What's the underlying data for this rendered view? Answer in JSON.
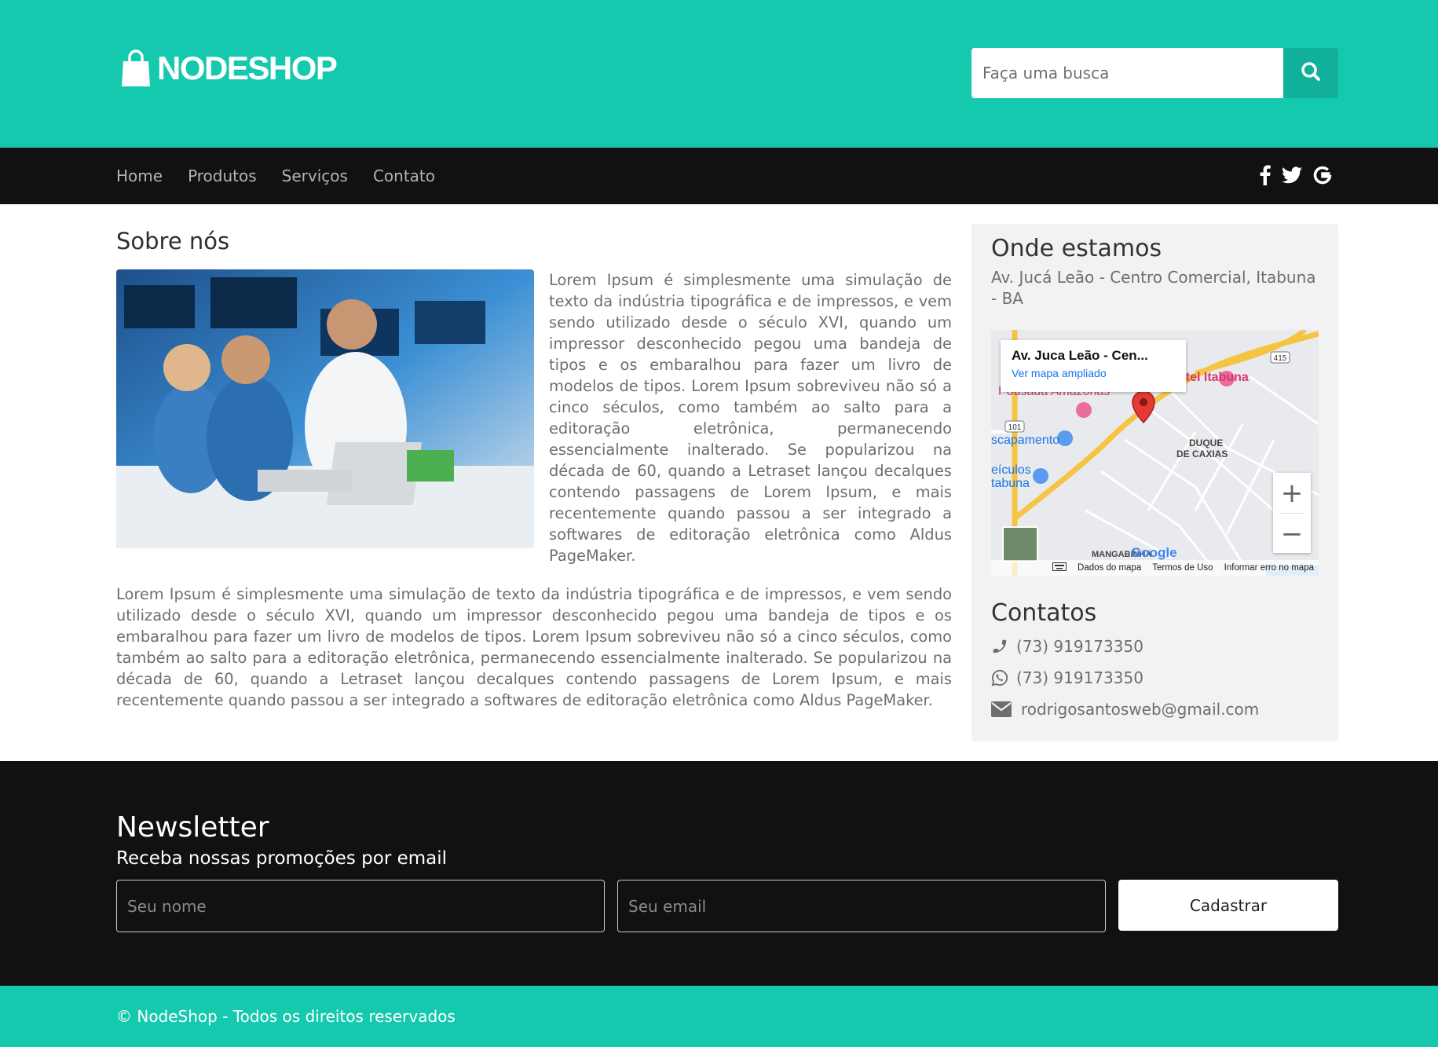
{
  "header": {
    "logo_text": "NODESHOP",
    "search_placeholder": "Faça uma busca"
  },
  "nav": {
    "items": [
      "Home",
      "Produtos",
      "Serviços",
      "Contato"
    ],
    "social_icons": [
      "facebook-icon",
      "twitter-icon",
      "google-icon"
    ]
  },
  "about": {
    "title": "Sobre nós",
    "paragraph1": "Lorem Ipsum é simplesmente uma simulação de texto da indústria tipográfica e de impressos, e vem sendo utilizado desde o século XVI, quando um impressor desconhecido pegou uma bandeja de tipos e os embaralhou para fazer um livro de modelos de tipos. Lorem Ipsum sobreviveu não só a cinco séculos, como também ao salto para a editoração eletrônica, permanecendo essencialmente inalterado. Se popularizou na década de 60, quando a Letraset lançou decalques contendo passagens de Lorem Ipsum, e mais recentemente quando passou a ser integrado a softwares de editoração eletrônica como Aldus PageMaker.",
    "paragraph2": "Lorem Ipsum é simplesmente uma simulação de texto da indústria tipográfica e de impressos, e vem sendo utilizado desde o século XVI, quando um impressor desconhecido pegou uma bandeja de tipos e os embaralhou para fazer um livro de modelos de tipos. Lorem Ipsum sobreviveu não só a cinco séculos, como também ao salto para a editoração eletrônica, permanecendo essencialmente inalterado. Se popularizou na década de 60, quando a Letraset lançou decalques contendo passagens de Lorem Ipsum, e mais recentemente quando passou a ser integrado a softwares de editoração eletrônica como Aldus PageMaker."
  },
  "location": {
    "title": "Onde estamos",
    "address": "Av. Jucá Leão - Centro Comercial, Itabuna - BA",
    "map": {
      "card_title": "Av. Juca Leão - Cen...",
      "card_link": "Ver mapa ampliado",
      "labels": {
        "pousada": "Pousada Amazonas",
        "hotel": "otel Itabuna",
        "escapamento": "scapamento",
        "veiculos": "eículos",
        "itabuna": "tabuna",
        "duque": "DUQUE",
        "de_caxias": "DE CAXIAS",
        "mangabinha": "MANGABINHA",
        "road_415": "415",
        "road_101": "101"
      },
      "zoom_in": "+",
      "zoom_out": "−",
      "footer_links": [
        "Dados do mapa",
        "Termos de Uso",
        "Informar erro no mapa"
      ],
      "google": "Google"
    }
  },
  "contacts": {
    "title": "Contatos",
    "phone": "(73) 919173350",
    "whatsapp": "(73) 919173350",
    "email": "rodrigosantosweb@gmail.com"
  },
  "newsletter": {
    "title": "Newsletter",
    "subtitle": "Receba nossas promoções por email",
    "name_placeholder": "Seu nome",
    "email_placeholder": "Seu email",
    "submit_label": "Cadastrar"
  },
  "footer": {
    "copyright": "© NodeShop - Todos os direitos reservados"
  },
  "colors": {
    "brand": "#15c9ae",
    "brand_dark": "#10b09a",
    "dark": "#111111"
  }
}
